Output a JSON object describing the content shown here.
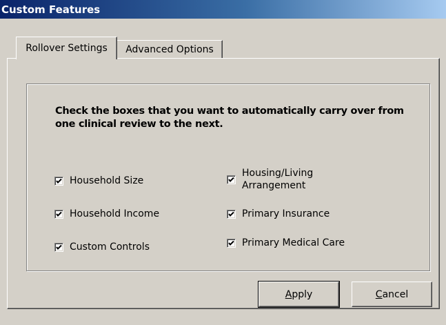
{
  "window": {
    "title": "Custom Features"
  },
  "tabs": [
    {
      "label": "Rollover Settings",
      "active": true
    },
    {
      "label": "Advanced Options",
      "active": false
    }
  ],
  "instructions": "Check the boxes that you want to automatically carry over from one clinical review to the next.",
  "checkboxes": {
    "left": [
      {
        "label": "Household Size",
        "checked": true
      },
      {
        "label": "Household Income",
        "checked": true
      },
      {
        "label": "Custom Controls",
        "checked": true
      }
    ],
    "right": [
      {
        "label": "Housing/Living Arrangement",
        "label_line1": "Housing/Living",
        "label_line2": "Arrangement",
        "checked": true
      },
      {
        "label": "Primary Insurance",
        "checked": true
      },
      {
        "label": "Primary Medical Care",
        "checked": true
      }
    ]
  },
  "buttons": {
    "apply": {
      "label": "Apply",
      "mnemonic": "A",
      "rest": "pply"
    },
    "cancel": {
      "label": "Cancel",
      "mnemonic": "C",
      "rest": "ancel"
    }
  },
  "colors": {
    "titlebar_start": "#0a246a",
    "titlebar_end": "#a6caf0",
    "face": "#d4d0c8"
  }
}
